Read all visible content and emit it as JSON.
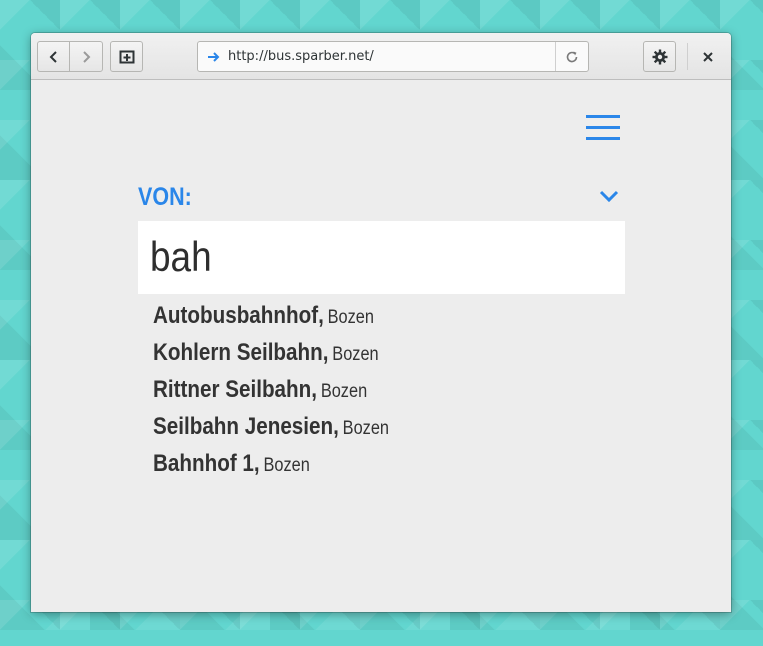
{
  "browser": {
    "url": "http://bus.sparber.net/",
    "icons": {
      "back": "chevron-left-icon",
      "forward": "chevron-right-icon",
      "new_tab": "new-tab-icon",
      "reload": "reload-icon",
      "settings": "gear-icon",
      "close": "close-icon",
      "url_security": "arrow-right-icon"
    }
  },
  "page": {
    "from_label": "VON:",
    "search_value": "bah",
    "results": [
      {
        "name": "Autobusbahnhof,",
        "city": "Bozen"
      },
      {
        "name": "Kohlern Seilbahn,",
        "city": "Bozen"
      },
      {
        "name": "Rittner Seilbahn,",
        "city": "Bozen"
      },
      {
        "name": "Seilbahn Jenesien,",
        "city": "Bozen"
      },
      {
        "name": "Bahnhof 1,",
        "city": "Bozen"
      }
    ]
  },
  "colors": {
    "accent": "#2a86e9",
    "background": "#ededed",
    "text": "#333333",
    "desktop": "#62d6cf"
  }
}
